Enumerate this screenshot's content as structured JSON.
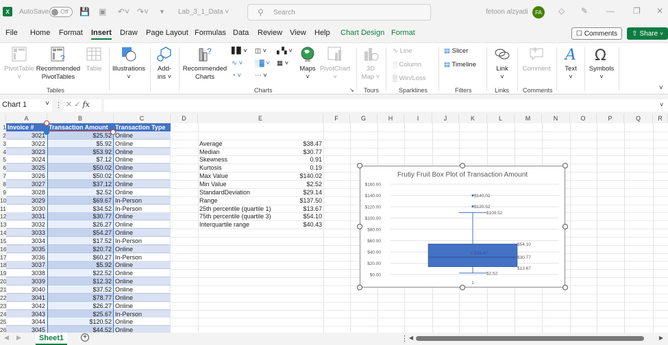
{
  "titlebar": {
    "app_icon": "excel-logo",
    "autosave_label": "AutoSave",
    "autosave_state": "Off",
    "doc_title": "Lab_3_1_Data",
    "search_placeholder": "Search",
    "user_name": "fetoon alzyadi",
    "user_initials": "FA"
  },
  "menu": {
    "items": [
      "File",
      "Home",
      "Format",
      "Insert",
      "Draw",
      "Page Layout",
      "Formulas",
      "Data",
      "Review",
      "View",
      "Help",
      "Chart Design",
      "Format"
    ],
    "active": "Insert",
    "comments_label": "Comments",
    "share_label": "Share"
  },
  "ribbon": {
    "pivot_table": "PivotTable",
    "recommended_pivot_1": "Recommended",
    "recommended_pivot_2": "PivotTables",
    "table": "Table",
    "tables_group": "Tables",
    "illustrations": "Illustrations",
    "addins_1": "Add-",
    "addins_2": "ins",
    "recommended_charts_1": "Recommended",
    "recommended_charts_2": "Charts",
    "maps": "Maps",
    "pivot_chart": "PivotChart",
    "charts_group": "Charts",
    "map3d_1": "3D",
    "map3d_2": "Map",
    "tours_group": "Tours",
    "spark_line": "Line",
    "spark_column": "Column",
    "spark_winloss": "Win/Loss",
    "sparklines_group": "Sparklines",
    "slicer": "Slicer",
    "timeline": "Timeline",
    "filters_group": "Filters",
    "link": "Link",
    "links_group": "Links",
    "comment": "Comment",
    "comments_group": "Comments",
    "text": "Text",
    "symbols": "Symbols"
  },
  "formula_bar": {
    "name_box": "Chart 1",
    "fx": "fx",
    "value": ""
  },
  "columns": [
    "A",
    "B",
    "C",
    "D",
    "E",
    "F",
    "G",
    "H",
    "I",
    "J",
    "K",
    "L",
    "M",
    "N",
    "O",
    "P",
    "Q",
    "R"
  ],
  "table": {
    "headers": [
      "Invoice #",
      "Transaction Amount",
      "Transaction Type"
    ],
    "rows": [
      [
        "3021",
        "$25.52",
        "Online"
      ],
      [
        "3022",
        "$5.92",
        "Online"
      ],
      [
        "3023",
        "$53.92",
        "Online"
      ],
      [
        "3024",
        "$7.12",
        "Online"
      ],
      [
        "3025",
        "$50.02",
        "Online"
      ],
      [
        "3026",
        "$50.02",
        "Online"
      ],
      [
        "3027",
        "$37.12",
        "Online"
      ],
      [
        "3028",
        "$2.52",
        "Online"
      ],
      [
        "3029",
        "$69.67",
        "In-Person"
      ],
      [
        "3030",
        "$34.52",
        "In-Person"
      ],
      [
        "3031",
        "$30.77",
        "Online"
      ],
      [
        "3032",
        "$26.27",
        "Online"
      ],
      [
        "3033",
        "$54.27",
        "Online"
      ],
      [
        "3034",
        "$17.52",
        "In-Person"
      ],
      [
        "3035",
        "$20.72",
        "Online"
      ],
      [
        "3036",
        "$60.27",
        "In-Person"
      ],
      [
        "3037",
        "$5.92",
        "Online"
      ],
      [
        "3038",
        "$22.52",
        "Online"
      ],
      [
        "3039",
        "$12.32",
        "Online"
      ],
      [
        "3040",
        "$37.52",
        "Online"
      ],
      [
        "3041",
        "$78.77",
        "Online"
      ],
      [
        "3042",
        "$26.27",
        "Online"
      ],
      [
        "3043",
        "$25.67",
        "In-Person"
      ],
      [
        "3044",
        "$120.52",
        "Online"
      ],
      [
        "3045",
        "$44.52",
        "Online"
      ]
    ]
  },
  "row_numbers": [
    "1",
    "2",
    "3",
    "4",
    "5",
    "6",
    "7",
    "8",
    "9",
    "10",
    "11",
    "12",
    "13",
    "14",
    "15",
    "16",
    "17",
    "18",
    "19",
    "20",
    "21",
    "22",
    "23",
    "24",
    "25",
    "26"
  ],
  "stats": [
    [
      "Average",
      "$38.47"
    ],
    [
      "Median",
      "$30.77"
    ],
    [
      "Skewness",
      "0.91"
    ],
    [
      "Kurtosis",
      "0.19"
    ],
    [
      "Max Value",
      "$140.02"
    ],
    [
      "Min Value",
      "$2.52"
    ],
    [
      "StandardDeviation",
      "$29.14"
    ],
    [
      "Range",
      "$137.50"
    ],
    [
      "25th percentile (quartile 1)",
      "$13.67"
    ],
    [
      "75th percentile (quartile 3)",
      "$54.10"
    ],
    [
      "Interquartile range",
      "$40.43"
    ]
  ],
  "chart_data": {
    "type": "box",
    "title": "Frutiy Fruit Box Plot of Transaction Amount",
    "categories": [
      "1"
    ],
    "ylim": [
      0,
      160
    ],
    "yticks": [
      "$0.00",
      "$20.00",
      "$40.00",
      "$60.00",
      "$80.00",
      "$100.00",
      "$120.00",
      "$140.00",
      "$160.00"
    ],
    "ytick_values": [
      0,
      20,
      40,
      60,
      80,
      100,
      120,
      140,
      160
    ],
    "box": {
      "min": 2.52,
      "q1": 13.67,
      "median": 30.77,
      "mean": 38.47,
      "q3": 54.1,
      "whisker_max": 109.52
    },
    "outliers": [
      120.52,
      140.02
    ],
    "labels": {
      "min": "$2.52",
      "q1": "$13.67",
      "median": "$30.77",
      "mean": "$38.47",
      "q3": "$54.10",
      "whisker_max": "$109.52",
      "outlier_1": "$120.52",
      "outlier_2": "$140.02"
    },
    "color": "#4472c4",
    "grid": true
  },
  "statusbar": {
    "sheet_tab": "Sheet1",
    "add_sheet": "+"
  },
  "colors": {
    "accent": "#107c41",
    "table_header": "#4472c4",
    "band": "#d9e1f2"
  }
}
